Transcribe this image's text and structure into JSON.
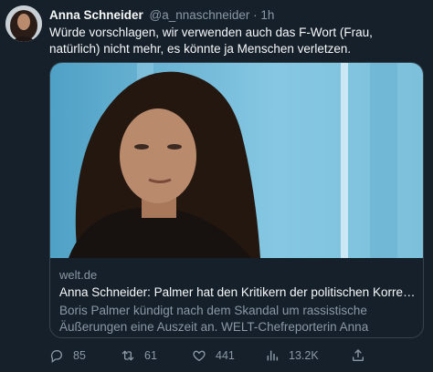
{
  "tweet": {
    "author_name": "Anna Schneider",
    "handle": "@a_nnaschneider",
    "separator": "·",
    "time": "1h",
    "text": "Würde vorschlagen, wir verwenden auch das F-Wort (Frau, natürlich) nicht mehr, es könnte ja Menschen verletzen."
  },
  "card": {
    "domain": "welt.de",
    "title": "Anna Schneider: Palmer hat den Kritikern der politischen Korrektheit...",
    "description": "Boris Palmer kündigt nach dem Skandal um rassistische Äußerungen eine Auszeit an. WELT-Chefreporterin Anna Schneider findet: „Palm..."
  },
  "actions": {
    "replies": "85",
    "retweets": "61",
    "likes": "441",
    "views": "13.2K"
  },
  "icons": [
    "avatar",
    "reply-icon",
    "retweet-icon",
    "like-icon",
    "views-icon",
    "share-icon"
  ],
  "colors": {
    "background": "#15202b",
    "secondary_text": "#8b98a5",
    "border": "#38444d"
  }
}
